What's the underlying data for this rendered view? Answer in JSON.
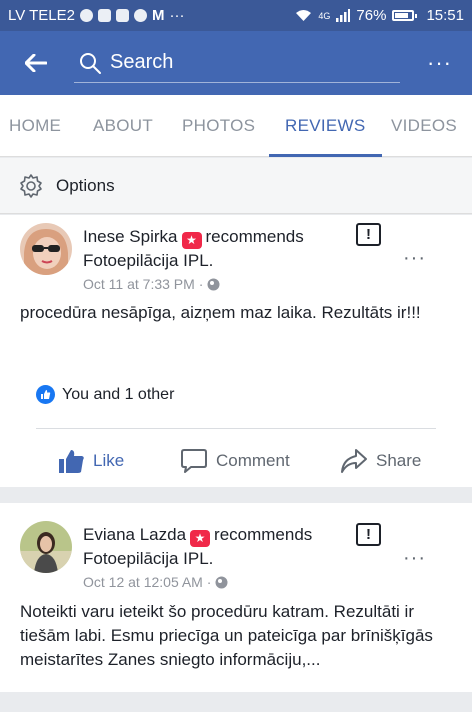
{
  "status_bar": {
    "carrier": "LV TELE2",
    "network": "4G",
    "battery": "76%",
    "time": "15:51",
    "more": "···"
  },
  "header": {
    "search_placeholder": "Search",
    "menu": "···"
  },
  "tabs": [
    {
      "label": "HOME",
      "active": false
    },
    {
      "label": "ABOUT",
      "active": false
    },
    {
      "label": "PHOTOS",
      "active": false
    },
    {
      "label": "REVIEWS",
      "active": true
    },
    {
      "label": "VIDEOS",
      "active": false
    }
  ],
  "options": {
    "label": "Options"
  },
  "posts": [
    {
      "author": "Inese Spirka",
      "action": "recommends",
      "page": "Fotoepilācija IPL.",
      "date": "Oct 11 at 7:33 PM",
      "separator": "·",
      "text": "procedūra nesāpīga, aizņem maz laika. Rezultāts ir!!!",
      "reactions": "You and 1 other",
      "like": "Like",
      "comment": "Comment",
      "share": "Share"
    },
    {
      "author": "Eviana Lazda",
      "action": "recommends",
      "page": "Fotoepilācija IPL.",
      "date": "Oct 12 at 12:05 AM",
      "separator": "·",
      "text": "Noteikti varu ieteikt šo procedūru katram. Rezultāti ir tiešām labi. Esmu priecīga un pateicīga par brīnišķīgās meistarītes Zanes sniegto informāciju,..."
    }
  ],
  "colors": {
    "brand": "#4267b2",
    "status_bar": "#3b5998",
    "like_blue": "#1877f2",
    "badge_red": "#f02849"
  }
}
